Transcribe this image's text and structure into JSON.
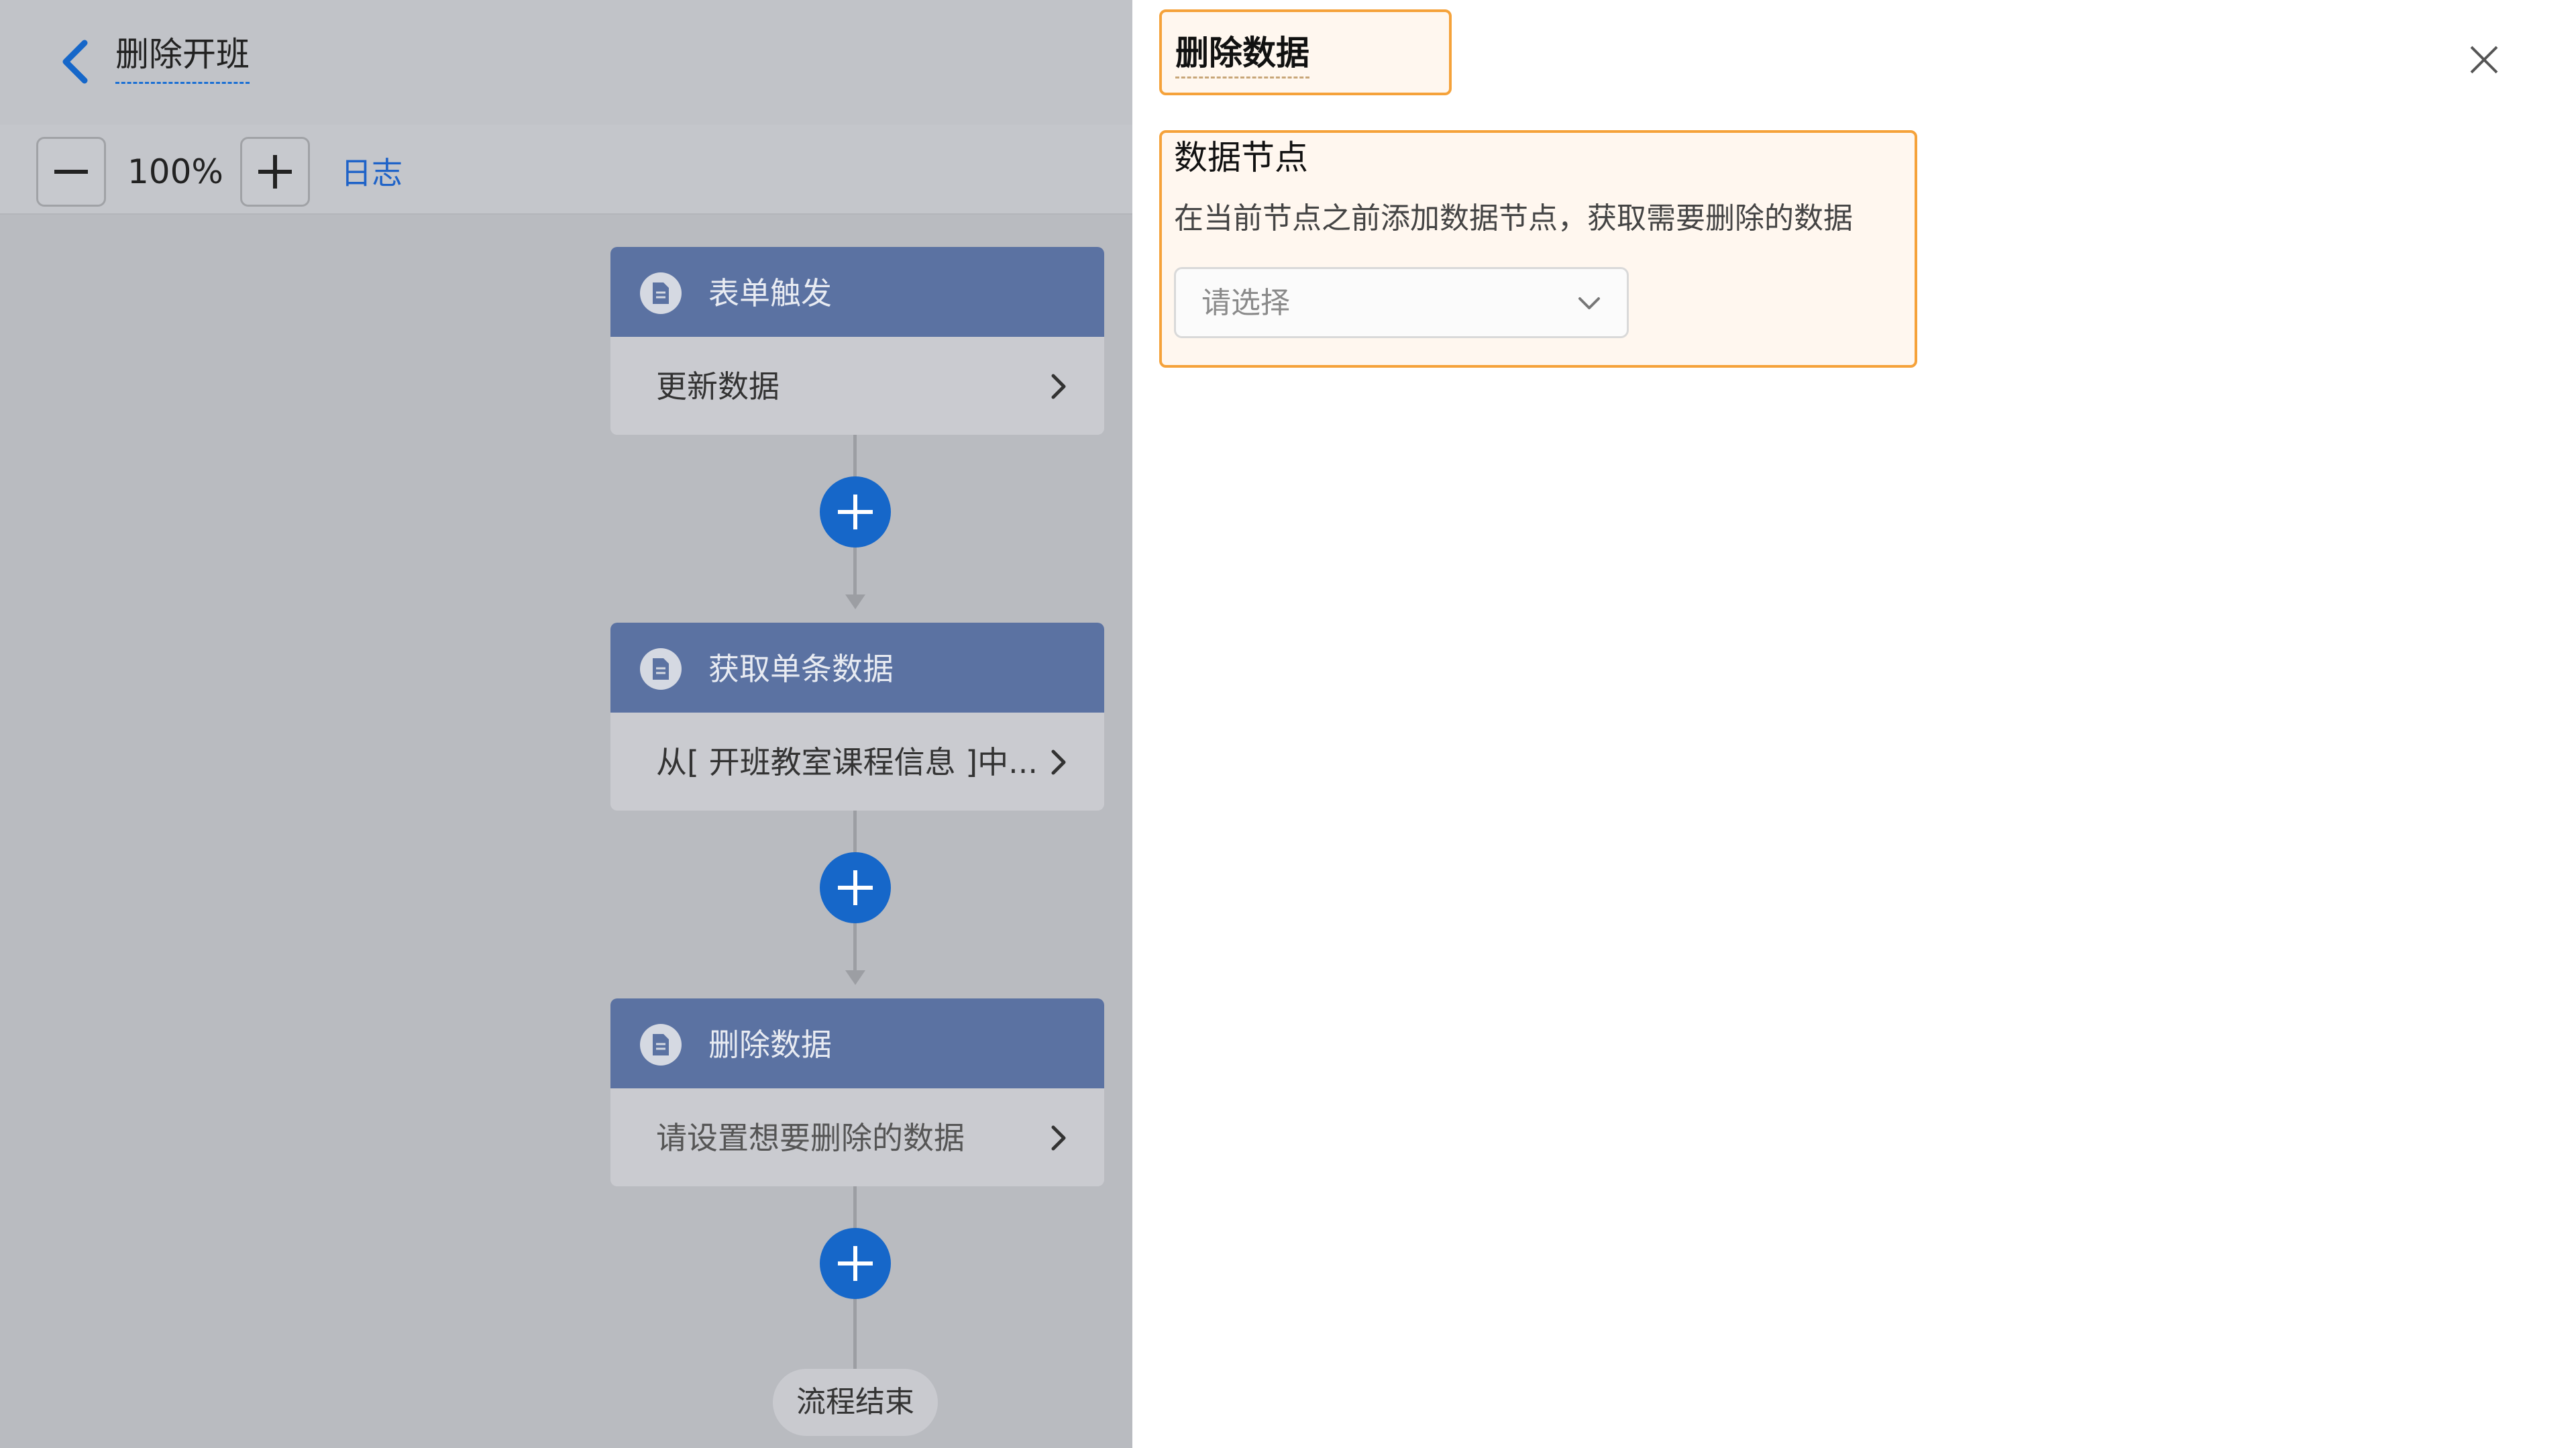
{
  "header": {
    "title": "删除开班"
  },
  "toolbar": {
    "zoom_level": "100%",
    "log_label": "日志"
  },
  "flow": {
    "nodes": [
      {
        "title": "表单触发",
        "body": "更新数据"
      },
      {
        "title": "获取单条数据",
        "body": "从[ 开班教室课程信息 ]中..."
      },
      {
        "title": "删除数据",
        "body": "请设置想要删除的数据"
      }
    ],
    "end_label": "流程结束"
  },
  "panel": {
    "title": "删除数据",
    "section_title": "数据节点",
    "section_desc": "在当前节点之前添加数据节点，获取需要删除的数据",
    "select_placeholder": "请选择"
  },
  "colors": {
    "accent_blue": "#1667c9",
    "node_header": "#5b72a2",
    "highlight_border": "#f5a23a"
  },
  "icons": [
    "chevron-left-icon",
    "minus-icon",
    "plus-icon",
    "document-icon",
    "chevron-right-icon",
    "close-icon",
    "chevron-down-icon"
  ]
}
